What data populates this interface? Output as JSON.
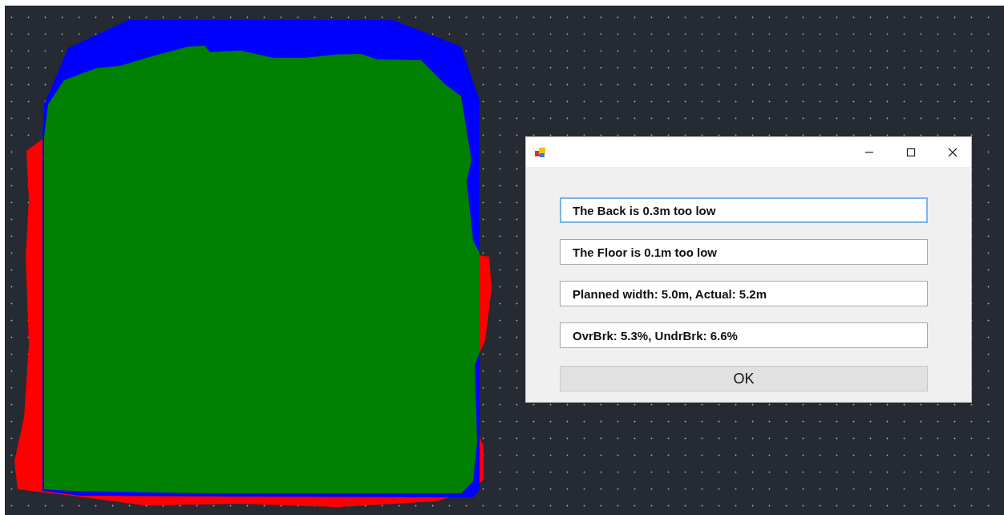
{
  "canvas": {
    "shapes": [
      {
        "kind": "outline",
        "color": "#ff0000"
      },
      {
        "kind": "outline",
        "color": "#0000ff"
      },
      {
        "kind": "outline",
        "color": "#008000"
      }
    ]
  },
  "dialog": {
    "buttons": [
      {
        "kind": "minimize"
      },
      {
        "kind": "maximize"
      },
      {
        "kind": "close"
      }
    ],
    "fields": [
      {
        "value": "The Back is 0.3m too low",
        "focused": true
      },
      {
        "value": "The Floor is 0.1m too low",
        "focused": false
      },
      {
        "value": "Planned width: 5.0m, Actual: 5.2m",
        "focused": false
      },
      {
        "value": "OvrBrk: 5.3%, UndrBrk: 6.6%",
        "focused": false
      }
    ],
    "ok_button": "OK"
  }
}
